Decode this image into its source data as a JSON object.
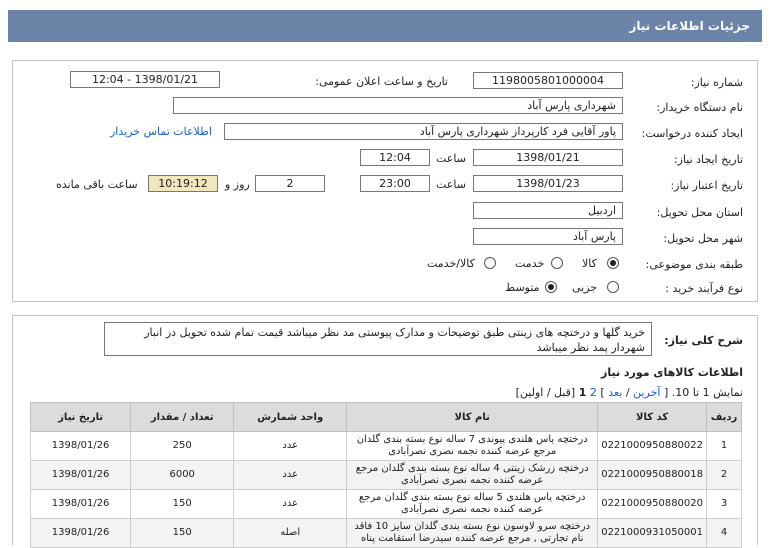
{
  "window": {
    "title": "جزئیات اطلاعات نیاز"
  },
  "form": {
    "need_number_label": "شماره نیاز:",
    "need_number": "1198005801000004",
    "announce_label": "تاریخ و ساعت اعلان عمومی:",
    "announce_value": "1398/01/21 - 12:04",
    "buyer_org_label": "نام دستگاه خریدار:",
    "buyer_org": "شهرداری پارس آباد",
    "requester_label": "ایجاد کننده درخواست:",
    "requester": "پاور آقایی فرد کارپرداز شهرداری پارس آباد",
    "contact_link": "اطلاعات تماس خریدار",
    "created_label": "تاریخ ایجاد نیاز:",
    "created_date": "1398/01/21",
    "created_time_label": "ساعت",
    "created_time": "12:04",
    "valid_label": "تاریخ اعتبار نیاز:",
    "valid_date": "1398/01/23",
    "valid_time_label": "ساعت",
    "valid_time": "23:00",
    "days": "2",
    "days_label": "روز و",
    "remaining_time": "10:19:12",
    "remaining_label": "ساعت باقی مانده",
    "province_label": "استان محل تحویل:",
    "province": "اردبیل",
    "city_label": "شهر محل تحویل:",
    "city": "پارس آباد",
    "category_label": "طبقه بندی موضوعی:",
    "category_options": [
      "کالا",
      "خدمت",
      "کالا/خدمت"
    ],
    "category_selected": "کالا",
    "process_label": "نوع فرآیند خرید :",
    "process_options": [
      "جزیی",
      "متوسط"
    ],
    "process_selected": "متوسط"
  },
  "description": {
    "label": "شرح کلی نیاز:",
    "text": "خرید گلها و درختچه های زینتی طبق توضیحات و مدارک پیوستی مد نظر میباشد قیمت تمام شده تحویل در انبار شهردار پمد نظر میباشد"
  },
  "goods": {
    "title": "اطلاعات کالاهای مورد نیاز",
    "pager_prefix": "نمایش 1 تا 10.",
    "pager_nav_open": "[",
    "pager_last": "آخرین",
    "pager_sep": "/",
    "pager_next": "بعد",
    "pager_close": "]",
    "pager_page2": "2",
    "pager_current": "1",
    "pager_tail": "[قبل / اولین]",
    "headers": [
      "ردیف",
      "کد کالا",
      "نام کالا",
      "واحد شمارش",
      "تعداد / مقدار",
      "تاریخ نیاز"
    ],
    "rows": [
      {
        "idx": "1",
        "code": "0221000950880022",
        "name": "درختچه یاس هلندی پیوندی 7 ساله نوع بسته بندی گلدان مرجع عرضه کننده نجمه نصری نصرآبادی",
        "unit": "عدد",
        "qty": "250",
        "date": "1398/01/26"
      },
      {
        "idx": "2",
        "code": "0221000950880018",
        "name": "درختچه زرشک زینتی 4 ساله نوع بسته بندی گلدان مرجع عرضه کننده نجمه نصری نصرآبادی",
        "unit": "عدد",
        "qty": "6000",
        "date": "1398/01/26"
      },
      {
        "idx": "3",
        "code": "0221000950880020",
        "name": "درختچه یاس هلندی 5 ساله نوع بسته بندی گلدان مرجع عرضه کننده نجمه نصری نصرآبادی",
        "unit": "عدد",
        "qty": "150",
        "date": "1398/01/26"
      },
      {
        "idx": "4",
        "code": "0221000931050001",
        "name": "درختچه سرو لاوسون نوع بسته بندی گلدان سایز 10 فاقد نام تجارتی , مرجع عرضه کننده سیدرضا استقامت پناه",
        "unit": "اصله",
        "qty": "150",
        "date": "1398/01/26"
      }
    ]
  }
}
